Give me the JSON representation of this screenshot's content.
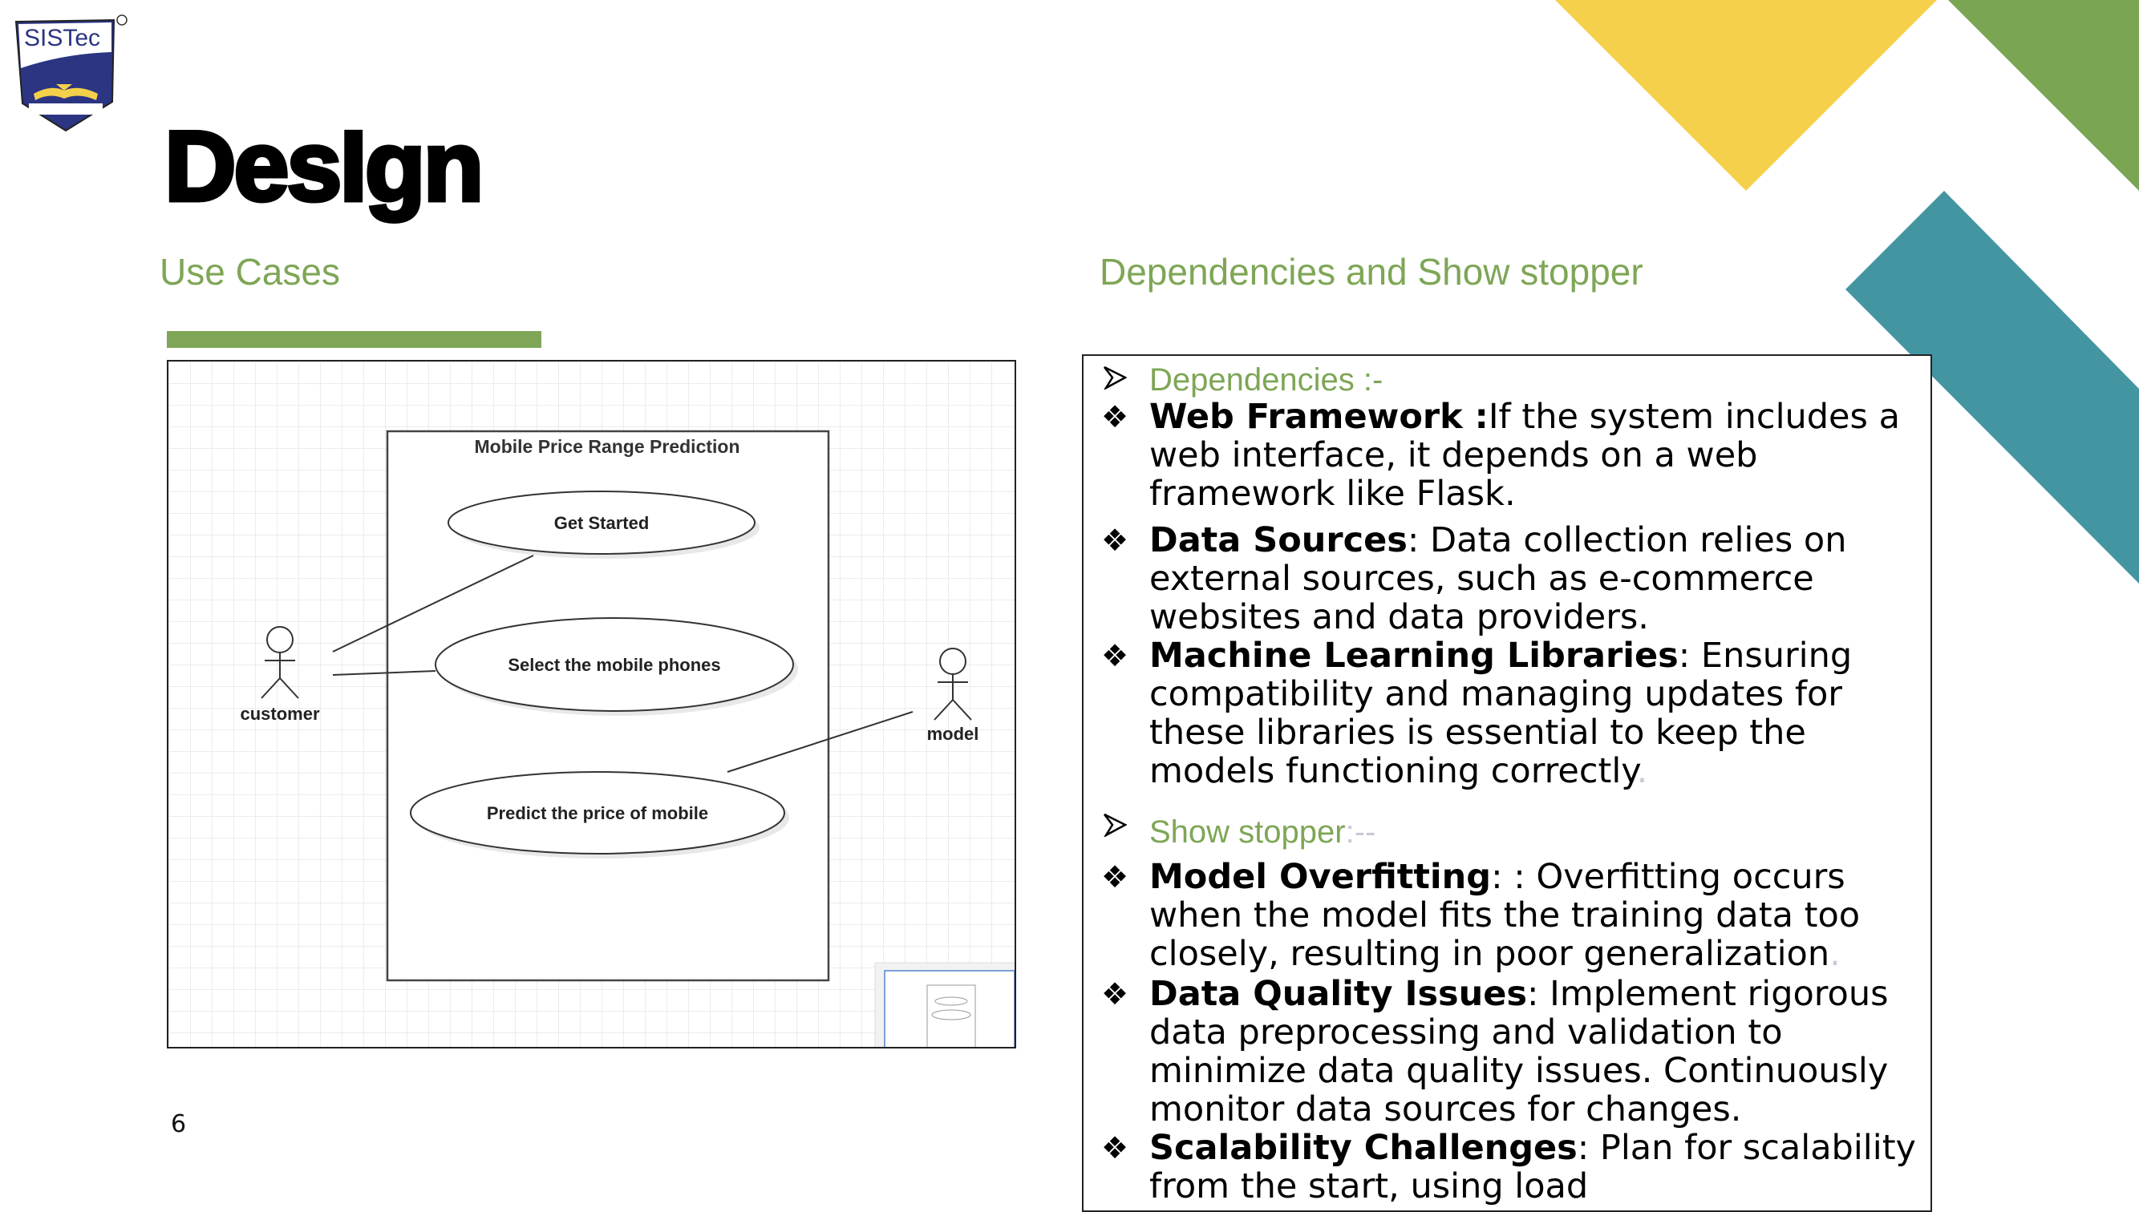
{
  "slide": {
    "title": "DesIgn",
    "page_number": "6",
    "logo_text": "SISTec",
    "colors": {
      "accent_green": "#7ea656",
      "yellow": "#f5d04a",
      "teal": "#4495a2",
      "dark_green": "#7aa653",
      "logo_navy": "#2b3582"
    }
  },
  "left": {
    "heading": "Use Cases",
    "diagram": {
      "system_title": "Mobile Price Range Prediction",
      "use_cases": [
        "Get Started",
        "Select the mobile phones",
        "Predict the price of mobile"
      ],
      "actors": [
        "customer",
        "model"
      ]
    }
  },
  "right": {
    "heading": "Dependencies and Show stopper",
    "dependencies_label": "Dependencies :-",
    "dependencies": [
      {
        "term": "Web Framework :",
        "text": "If the system includes a web interface, it depends on a web framework like Flask."
      },
      {
        "term": "Data Sources",
        "text": ": Data collection relies on external sources, such as e-commerce websites and data providers."
      },
      {
        "term": "Machine Learning Libraries",
        "text": ": Ensuring compatibility and managing updates for these libraries is essential to keep the models functioning correctly",
        "tail": "."
      }
    ],
    "showstopper_label": "Show stopper",
    "showstopper_tail": ":--",
    "showstoppers": [
      {
        "term": "Model Overfitting",
        "text": ": : Overfitting occurs when the model fits the training data too closely, resulting in poor generalization",
        "tail": "."
      },
      {
        "term": "Data Quality Issues",
        "text": ": Implement rigorous data preprocessing and validation to minimize data quality issues. Continuously monitor data sources for changes."
      },
      {
        "term": "Scalability Challenges",
        "text": ": Plan for scalability from the start, using load"
      }
    ],
    "bullet_icon": "four-diamond-bullet",
    "section_icon": "arrowhead-bullet"
  }
}
